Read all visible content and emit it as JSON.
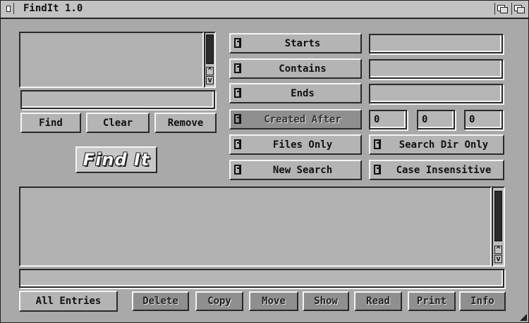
{
  "window": {
    "title": "FindIt 1.0"
  },
  "left": {
    "pattern_input_value": "",
    "find_label": "Find",
    "clear_label": "Clear",
    "remove_label": "Remove",
    "findit_label": "Find It"
  },
  "options": {
    "starts": {
      "label": "Starts",
      "value": ""
    },
    "contains": {
      "label": "Contains",
      "value": ""
    },
    "ends": {
      "label": "Ends",
      "value": ""
    },
    "created_after": {
      "label": "Created After",
      "day": "0",
      "month": "0",
      "year": "0"
    },
    "files_only_label": "Files Only",
    "search_dir_only_label": "Search Dir Only",
    "new_search_label": "New Search",
    "case_insensitive_label": "Case Insensitive"
  },
  "results": {
    "path_value": ""
  },
  "bottom_bar": {
    "all_entries_label": "All Entries",
    "delete_label": "Delete",
    "copy_label": "Copy",
    "move_label": "Move",
    "show_label": "Show",
    "read_label": "Read",
    "print_label": "Print",
    "info_label": "Info"
  },
  "icons": {
    "scroll_up": "^",
    "scroll_down": "v"
  }
}
